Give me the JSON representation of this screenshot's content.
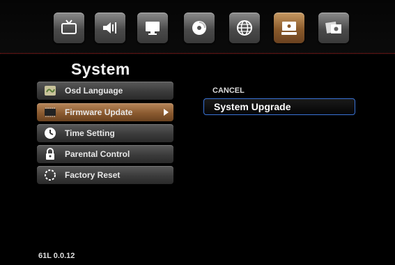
{
  "top_icons": [
    {
      "name": "tv-icon",
      "active": false
    },
    {
      "name": "speaker-icon",
      "active": false
    },
    {
      "name": "monitor-icon",
      "active": false
    },
    {
      "name": "disc-icon",
      "active": false
    },
    {
      "name": "globe-icon",
      "active": false
    },
    {
      "name": "system-icon",
      "active": true
    },
    {
      "name": "photo-icon",
      "active": false
    }
  ],
  "section_title": "System",
  "menu": [
    {
      "label": "Osd Language",
      "icon": "language-flag-icon",
      "selected": false
    },
    {
      "label": "Firmware Update",
      "icon": "chip-icon",
      "selected": true
    },
    {
      "label": "Time Setting",
      "icon": "clock-icon",
      "selected": false
    },
    {
      "label": "Parental Control",
      "icon": "lock-icon",
      "selected": false
    },
    {
      "label": "Factory Reset",
      "icon": "reset-icon",
      "selected": false
    }
  ],
  "submenu": {
    "cancel_label": "CANCEL",
    "option_label": "System Upgrade"
  },
  "version": "61L 0.0.12",
  "colors": {
    "selected_tile": "#8a5a2b",
    "highlight_border": "#3a74d8",
    "divider": "#b01515"
  }
}
